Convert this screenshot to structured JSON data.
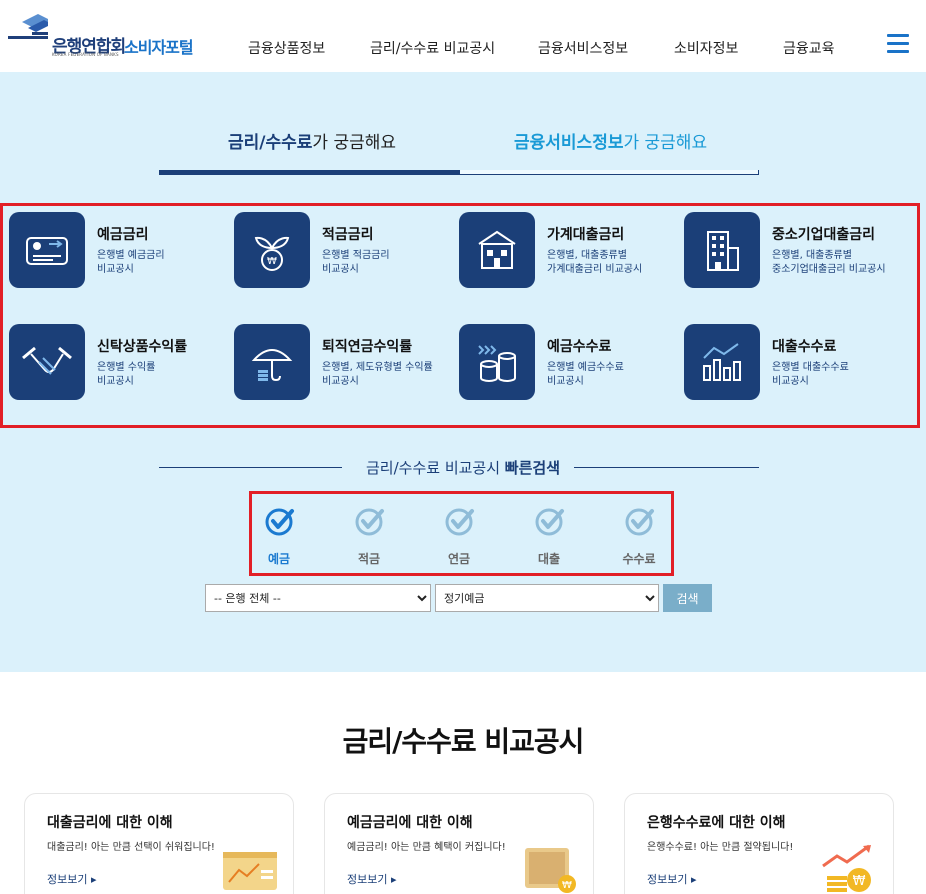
{
  "header": {
    "org_name": "은행연합회",
    "org_english": "KOREA FEDERATION OF BANKS",
    "portal_name": "소비자포털",
    "nav": [
      "금융상품정보",
      "금리/수수료 비교공시",
      "금융서비스정보",
      "소비자정보",
      "금융교육"
    ]
  },
  "tabs": [
    {
      "strong": "금리/수수료",
      "rest": "가 궁금해요"
    },
    {
      "strong": "금융서비스정보",
      "rest": "가 궁금해요"
    }
  ],
  "services": [
    {
      "title": "예금금리",
      "desc": "은행별 예금금리\n비교공시",
      "icon": "deposit-card-icon"
    },
    {
      "title": "적금금리",
      "desc": "은행별 적금금리\n비교공시",
      "icon": "savings-plant-icon"
    },
    {
      "title": "가계대출금리",
      "desc": "은행별, 대출종류별\n가계대출금리 비교공시",
      "icon": "house-building-icon"
    },
    {
      "title": "중소기업대출금리",
      "desc": "은행별, 대출종류별\n중소기업대출금리 비교공시",
      "icon": "office-building-icon"
    },
    {
      "title": "신탁상품수익률",
      "desc": "은행별 수익률\n비교공시",
      "icon": "handshake-icon"
    },
    {
      "title": "퇴직연금수익률",
      "desc": "은행별, 제도유형별 수익률\n비교공시",
      "icon": "umbrella-coins-icon"
    },
    {
      "title": "예금수수료",
      "desc": "은행별 예금수수료\n비교공시",
      "icon": "coin-stacks-icon"
    },
    {
      "title": "대출수수료",
      "desc": "은행별 대출수수료\n비교공시",
      "icon": "bar-chart-icon"
    }
  ],
  "quick_search": {
    "title_normal": "금리/수수료 비교공시 ",
    "title_bold": "빠른검색",
    "options": [
      "예금",
      "적금",
      "연금",
      "대출",
      "수수료"
    ],
    "selected": "예금",
    "bank_select": "-- 은행 전체 --",
    "product_select": "정기예금",
    "search_label": "검색"
  },
  "section": {
    "title": "금리/수수료 비교공시",
    "cards": [
      {
        "title": "대출금리에 대한 이해",
        "desc": "대출금리! 아는 만큼 선택이 쉬워집니다!",
        "link": "정보보기"
      },
      {
        "title": "예금금리에 대한 이해",
        "desc": "예금금리! 아는 만큼 혜택이 커집니다!",
        "link": "정보보기"
      },
      {
        "title": "은행수수료에 대한 이해",
        "desc": "은행수수료! 아는 만큼 절약됩니다!",
        "link": "정보보기"
      }
    ]
  },
  "colors": {
    "navy": "#1b3f78",
    "accent": "#1a73c8",
    "highlight_box": "#e21f26",
    "section_bg": "#dbf1fb"
  }
}
